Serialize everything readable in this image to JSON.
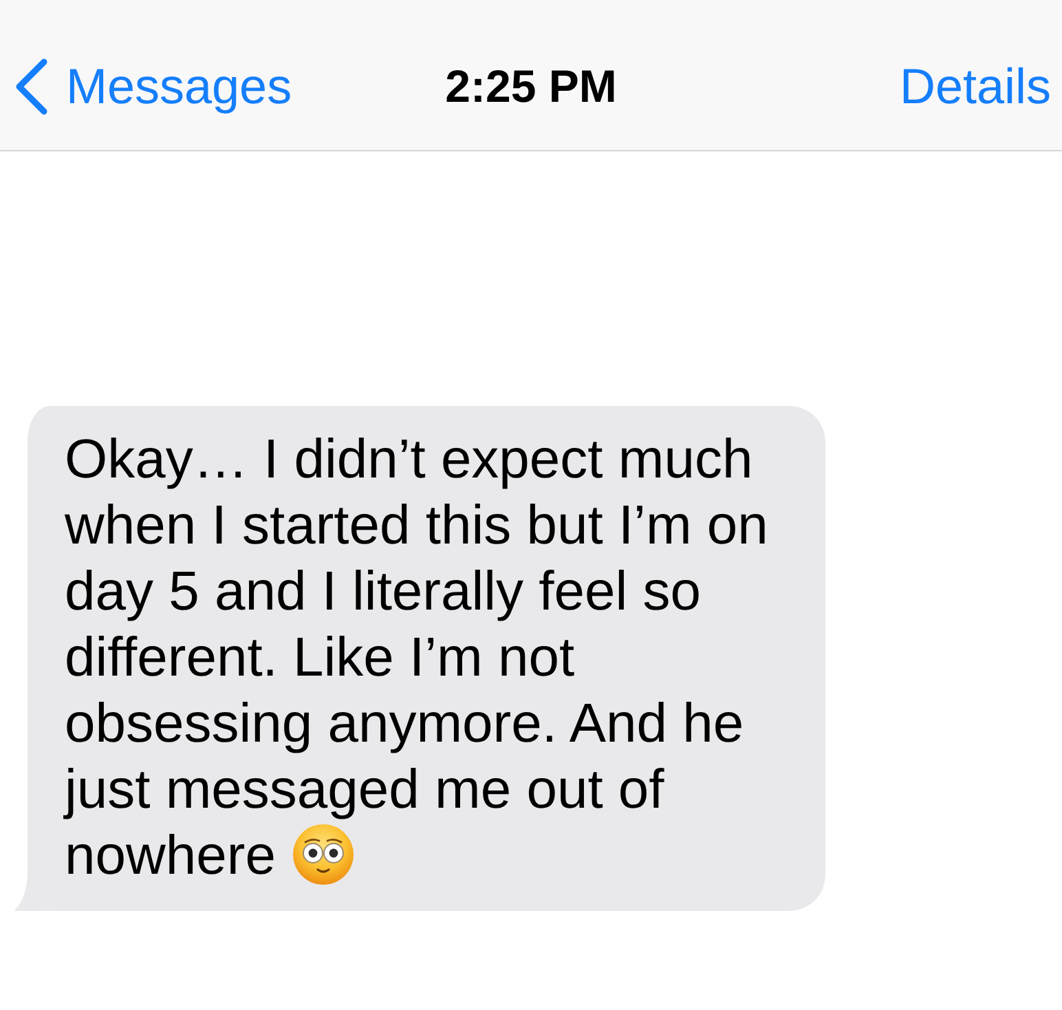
{
  "nav_bar": {
    "back_label": "Messages",
    "title": "2:25 PM",
    "action_label": "Details"
  },
  "messages": [
    {
      "kind": "received",
      "lines": [
        "Okay… I didn’t expect much",
        "when I started this but I’m on",
        "day 5 and I literally feel so",
        "different. Like I’m not",
        "obsessing anymore. And he",
        "just messaged me out of",
        "nowhere"
      ]
    }
  ]
}
